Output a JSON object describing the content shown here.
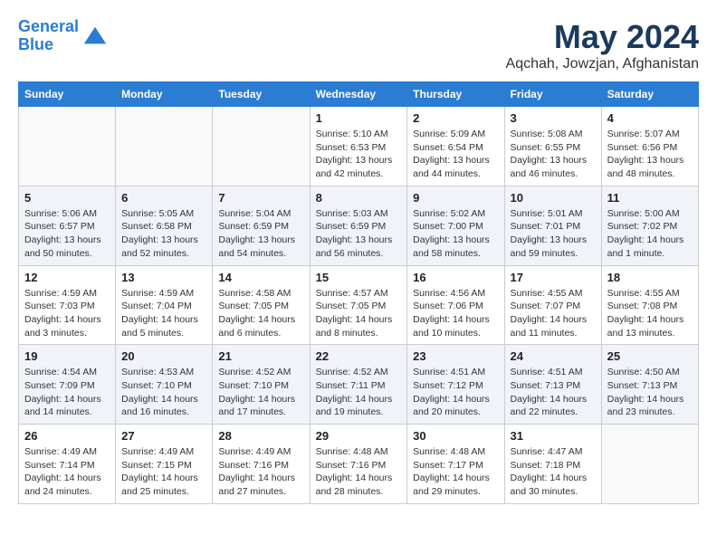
{
  "header": {
    "logo_line1": "General",
    "logo_line2": "Blue",
    "month": "May 2024",
    "location": "Aqchah, Jowzjan, Afghanistan"
  },
  "weekdays": [
    "Sunday",
    "Monday",
    "Tuesday",
    "Wednesday",
    "Thursday",
    "Friday",
    "Saturday"
  ],
  "weeks": [
    [
      {
        "day": "",
        "info": ""
      },
      {
        "day": "",
        "info": ""
      },
      {
        "day": "",
        "info": ""
      },
      {
        "day": "1",
        "info": "Sunrise: 5:10 AM\nSunset: 6:53 PM\nDaylight: 13 hours\nand 42 minutes."
      },
      {
        "day": "2",
        "info": "Sunrise: 5:09 AM\nSunset: 6:54 PM\nDaylight: 13 hours\nand 44 minutes."
      },
      {
        "day": "3",
        "info": "Sunrise: 5:08 AM\nSunset: 6:55 PM\nDaylight: 13 hours\nand 46 minutes."
      },
      {
        "day": "4",
        "info": "Sunrise: 5:07 AM\nSunset: 6:56 PM\nDaylight: 13 hours\nand 48 minutes."
      }
    ],
    [
      {
        "day": "5",
        "info": "Sunrise: 5:06 AM\nSunset: 6:57 PM\nDaylight: 13 hours\nand 50 minutes."
      },
      {
        "day": "6",
        "info": "Sunrise: 5:05 AM\nSunset: 6:58 PM\nDaylight: 13 hours\nand 52 minutes."
      },
      {
        "day": "7",
        "info": "Sunrise: 5:04 AM\nSunset: 6:59 PM\nDaylight: 13 hours\nand 54 minutes."
      },
      {
        "day": "8",
        "info": "Sunrise: 5:03 AM\nSunset: 6:59 PM\nDaylight: 13 hours\nand 56 minutes."
      },
      {
        "day": "9",
        "info": "Sunrise: 5:02 AM\nSunset: 7:00 PM\nDaylight: 13 hours\nand 58 minutes."
      },
      {
        "day": "10",
        "info": "Sunrise: 5:01 AM\nSunset: 7:01 PM\nDaylight: 13 hours\nand 59 minutes."
      },
      {
        "day": "11",
        "info": "Sunrise: 5:00 AM\nSunset: 7:02 PM\nDaylight: 14 hours\nand 1 minute."
      }
    ],
    [
      {
        "day": "12",
        "info": "Sunrise: 4:59 AM\nSunset: 7:03 PM\nDaylight: 14 hours\nand 3 minutes."
      },
      {
        "day": "13",
        "info": "Sunrise: 4:59 AM\nSunset: 7:04 PM\nDaylight: 14 hours\nand 5 minutes."
      },
      {
        "day": "14",
        "info": "Sunrise: 4:58 AM\nSunset: 7:05 PM\nDaylight: 14 hours\nand 6 minutes."
      },
      {
        "day": "15",
        "info": "Sunrise: 4:57 AM\nSunset: 7:05 PM\nDaylight: 14 hours\nand 8 minutes."
      },
      {
        "day": "16",
        "info": "Sunrise: 4:56 AM\nSunset: 7:06 PM\nDaylight: 14 hours\nand 10 minutes."
      },
      {
        "day": "17",
        "info": "Sunrise: 4:55 AM\nSunset: 7:07 PM\nDaylight: 14 hours\nand 11 minutes."
      },
      {
        "day": "18",
        "info": "Sunrise: 4:55 AM\nSunset: 7:08 PM\nDaylight: 14 hours\nand 13 minutes."
      }
    ],
    [
      {
        "day": "19",
        "info": "Sunrise: 4:54 AM\nSunset: 7:09 PM\nDaylight: 14 hours\nand 14 minutes."
      },
      {
        "day": "20",
        "info": "Sunrise: 4:53 AM\nSunset: 7:10 PM\nDaylight: 14 hours\nand 16 minutes."
      },
      {
        "day": "21",
        "info": "Sunrise: 4:52 AM\nSunset: 7:10 PM\nDaylight: 14 hours\nand 17 minutes."
      },
      {
        "day": "22",
        "info": "Sunrise: 4:52 AM\nSunset: 7:11 PM\nDaylight: 14 hours\nand 19 minutes."
      },
      {
        "day": "23",
        "info": "Sunrise: 4:51 AM\nSunset: 7:12 PM\nDaylight: 14 hours\nand 20 minutes."
      },
      {
        "day": "24",
        "info": "Sunrise: 4:51 AM\nSunset: 7:13 PM\nDaylight: 14 hours\nand 22 minutes."
      },
      {
        "day": "25",
        "info": "Sunrise: 4:50 AM\nSunset: 7:13 PM\nDaylight: 14 hours\nand 23 minutes."
      }
    ],
    [
      {
        "day": "26",
        "info": "Sunrise: 4:49 AM\nSunset: 7:14 PM\nDaylight: 14 hours\nand 24 minutes."
      },
      {
        "day": "27",
        "info": "Sunrise: 4:49 AM\nSunset: 7:15 PM\nDaylight: 14 hours\nand 25 minutes."
      },
      {
        "day": "28",
        "info": "Sunrise: 4:49 AM\nSunset: 7:16 PM\nDaylight: 14 hours\nand 27 minutes."
      },
      {
        "day": "29",
        "info": "Sunrise: 4:48 AM\nSunset: 7:16 PM\nDaylight: 14 hours\nand 28 minutes."
      },
      {
        "day": "30",
        "info": "Sunrise: 4:48 AM\nSunset: 7:17 PM\nDaylight: 14 hours\nand 29 minutes."
      },
      {
        "day": "31",
        "info": "Sunrise: 4:47 AM\nSunset: 7:18 PM\nDaylight: 14 hours\nand 30 minutes."
      },
      {
        "day": "",
        "info": ""
      }
    ]
  ]
}
